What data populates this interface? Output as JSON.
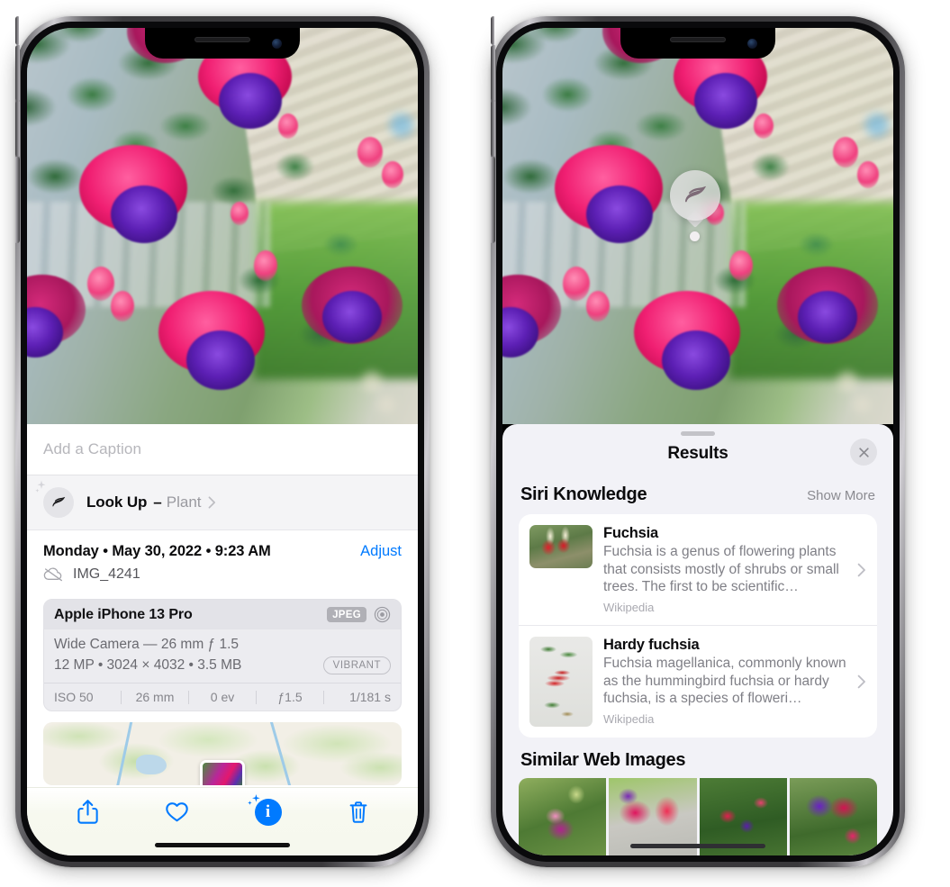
{
  "left_phone": {
    "photo": {
      "alt": "fuchsia-flowers-photo"
    },
    "caption": {
      "placeholder": "Add a Caption",
      "value": ""
    },
    "look_up": {
      "icon": "leaf-icon",
      "sparkle_icon": "sparkle-icon",
      "title": "Look Up",
      "dash": "–",
      "subject": "Plant",
      "chevron": "chevron-right-icon"
    },
    "metadata": {
      "date": "Monday • May 30, 2022 • 9:23 AM",
      "adjust_label": "Adjust",
      "cloud_icon": "cloud-slash-icon",
      "filename": "IMG_4241"
    },
    "camera_card": {
      "model": "Apple iPhone 13 Pro",
      "format_badge": "JPEG",
      "raw_icon": "aperture-icon",
      "lens": "Wide Camera — 26 mm ƒ 1.5",
      "specs": "12 MP • 3024 × 4032 • 3.5 MB",
      "style_badge": "VIBRANT",
      "exif": [
        "ISO 50",
        "26 mm",
        "0 ev",
        "ƒ1.5",
        "1/181 s"
      ]
    },
    "map": {
      "name": "location-map-thumbnail"
    },
    "toolbar": {
      "share": "share-icon",
      "favorite": "heart-icon",
      "info": "info-sparkle-icon",
      "delete": "trash-icon"
    }
  },
  "right_phone": {
    "photo": {
      "alt": "fuchsia-flowers-photo"
    },
    "lookup_badge": {
      "icon": "leaf-icon"
    },
    "sheet": {
      "title": "Results",
      "close_icon": "close-icon",
      "siri_knowledge": {
        "heading": "Siri Knowledge",
        "show_more": "Show More",
        "items": [
          {
            "title": "Fuchsia",
            "description": "Fuchsia is a genus of flowering plants that consists mostly of shrubs or small trees. The first to be scientific…",
            "source": "Wikipedia",
            "chevron": "chevron-right-icon"
          },
          {
            "title": "Hardy fuchsia",
            "description": "Fuchsia magellanica, commonly known as the hummingbird fuchsia or hardy fuchsia, is a species of floweri…",
            "source": "Wikipedia",
            "chevron": "chevron-right-icon"
          }
        ]
      },
      "similar_web_images": {
        "heading": "Similar Web Images",
        "thumbnails": [
          "web-image-1",
          "web-image-2",
          "web-image-3",
          "web-image-4"
        ]
      }
    }
  },
  "colors": {
    "accent_blue": "#007aff",
    "sheet_bg": "#f2f2f7",
    "card_bg": "#ffffff",
    "secondary_text": "#8a8a90"
  }
}
